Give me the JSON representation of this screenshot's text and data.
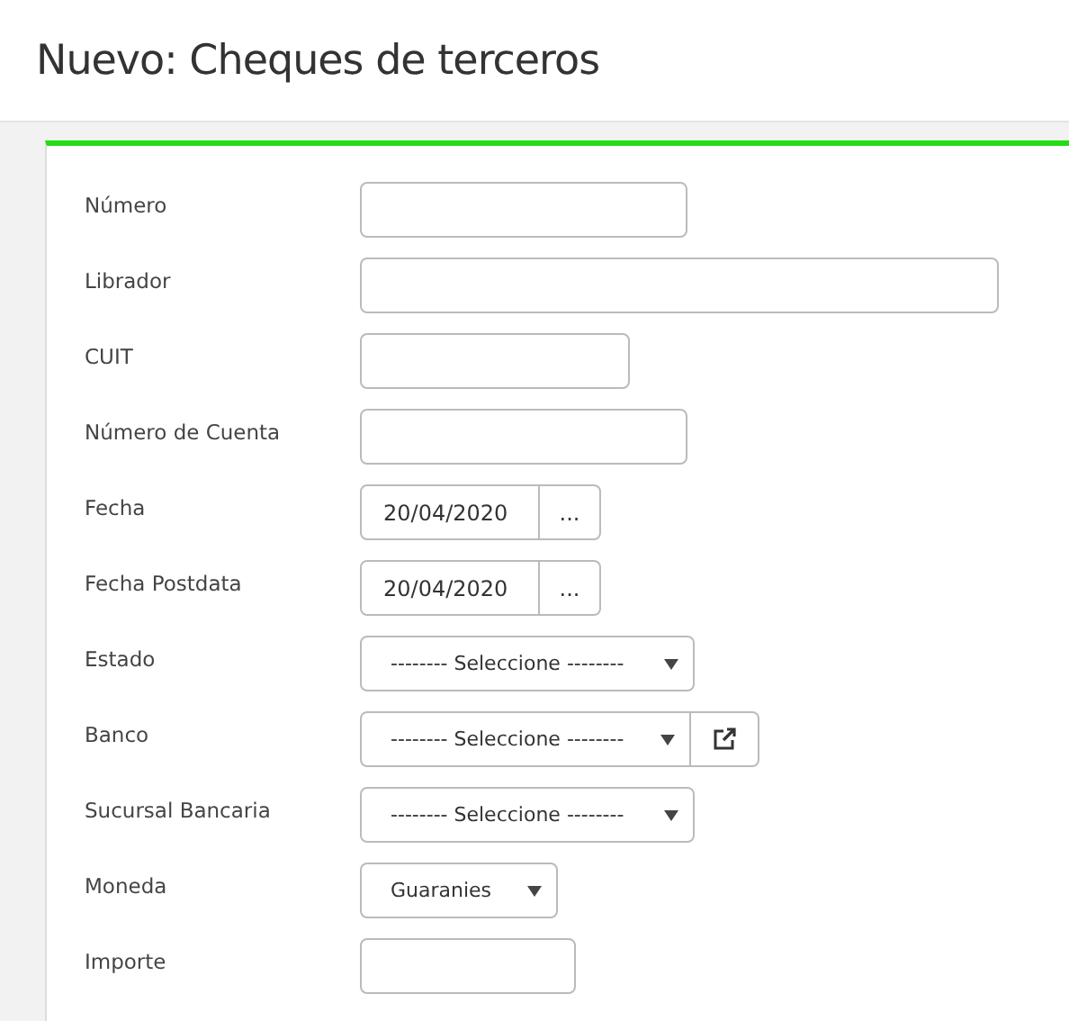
{
  "page_title": "Nuevo: Cheques de terceros",
  "fields": [
    {
      "label": "Número",
      "kind": "text"
    },
    {
      "label": "Librador",
      "kind": "text"
    },
    {
      "label": "CUIT",
      "kind": "text"
    },
    {
      "label": "Número de Cuenta",
      "kind": "text"
    },
    {
      "label": "Fecha",
      "kind": "date",
      "value": "20/04/2020",
      "button": "..."
    },
    {
      "label": "Fecha Postdata",
      "kind": "date",
      "value": "20/04/2020",
      "button": "..."
    },
    {
      "label": "Estado",
      "kind": "select",
      "value": "-------- Seleccione --------"
    },
    {
      "label": "Banco",
      "kind": "select-link",
      "value": "-------- Seleccione --------"
    },
    {
      "label": "Sucursal Bancaria",
      "kind": "select",
      "value": "-------- Seleccione --------"
    },
    {
      "label": "Moneda",
      "kind": "select",
      "value": "Guaranies"
    },
    {
      "label": "Importe",
      "kind": "text"
    }
  ]
}
